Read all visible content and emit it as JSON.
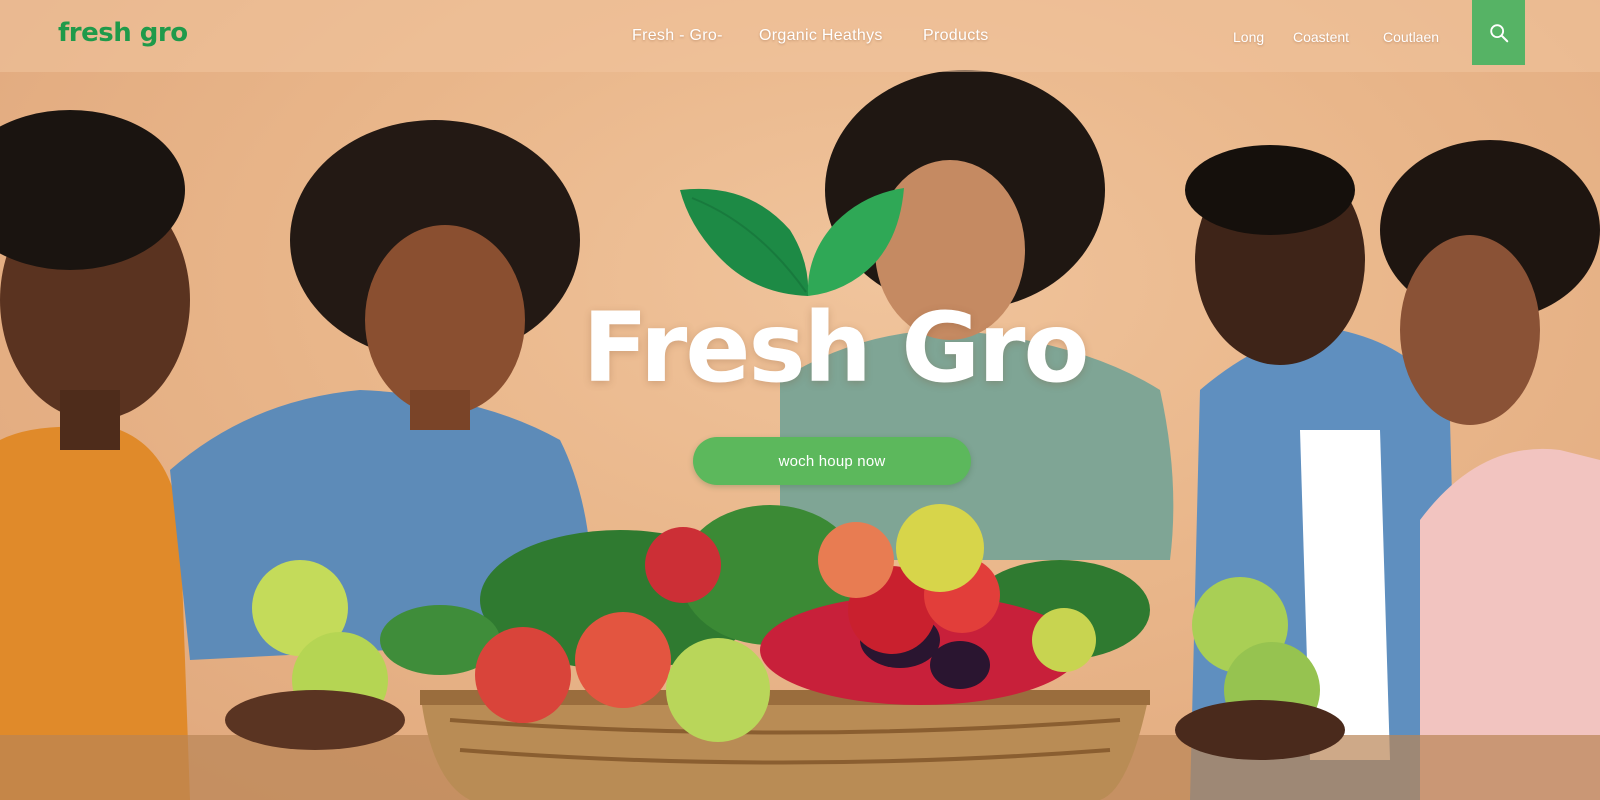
{
  "header": {
    "logo_text": "fresh gro",
    "nav_items": [
      {
        "label": "Fresh - Gro-"
      },
      {
        "label": "Organic Heathys"
      },
      {
        "label": "Products"
      }
    ],
    "right_links": [
      {
        "label": "Long"
      },
      {
        "label": "Coastent"
      },
      {
        "label": "Coutlaen"
      }
    ],
    "search_icon": "search-icon"
  },
  "hero": {
    "brand_title": "Fresh Gro",
    "leaf_icon": "leaf-icon",
    "cta_label": "woch houp now"
  },
  "colors": {
    "brand_green": "#1f9a4a",
    "button_green": "#5cb85c",
    "search_green": "#56b365",
    "leaf_dark": "#1d8a45",
    "leaf_light": "#2fa856",
    "background_peach": "#e9b68a"
  }
}
